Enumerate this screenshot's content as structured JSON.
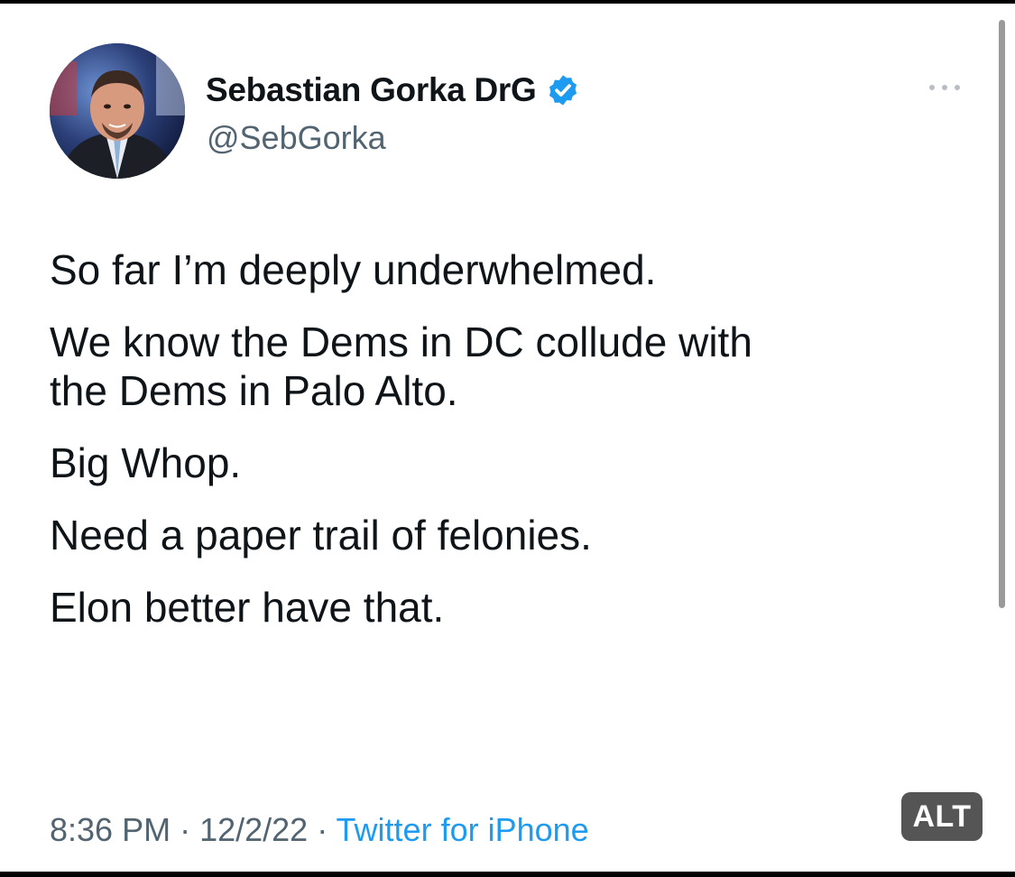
{
  "profile": {
    "display_name": "Sebastian Gorka DrG",
    "handle": "@SebGorka",
    "avatar": "avatar-photo",
    "verified_icon": "verified-badge-icon",
    "more_icon": "more-options-icon"
  },
  "tweet": {
    "paragraphs": [
      {
        "lines": [
          "So far I’m deeply underwhelmed."
        ]
      },
      {
        "lines": [
          "We know the Dems in DC collude with",
          "the Dems in Palo Alto."
        ]
      },
      {
        "lines": [
          "Big Whop."
        ]
      },
      {
        "lines": [
          "Need a paper trail of felonies."
        ]
      },
      {
        "lines": [
          "Elon better have that."
        ]
      }
    ]
  },
  "meta": {
    "time": "8:36 PM",
    "separator": " · ",
    "date": "12/2/22",
    "source": "Twitter for iPhone"
  },
  "alt_badge": "ALT",
  "colors": {
    "verified": "#1d9bf0",
    "text": "#0f1419",
    "secondary": "#536471",
    "link": "#1d9bf0",
    "alt_badge_bg": "#555555",
    "frame": "#000000"
  }
}
